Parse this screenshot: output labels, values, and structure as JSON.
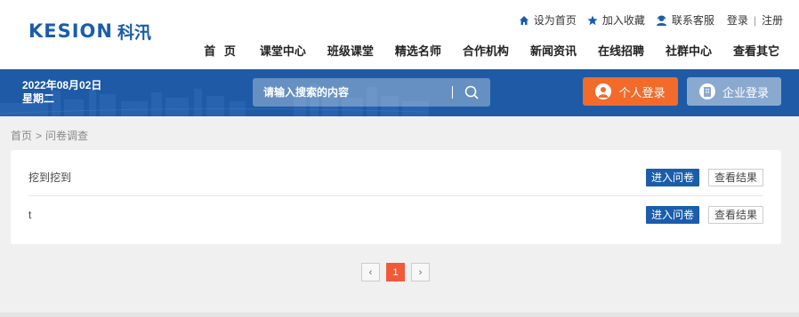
{
  "brand": {
    "logo_text": "KESION",
    "logo_cn": "科汛",
    "color": "#1a5dab"
  },
  "toplinks": [
    {
      "label": "设为首页",
      "icon": "home-icon"
    },
    {
      "label": "加入收藏",
      "icon": "star-icon"
    },
    {
      "label": "联系客服",
      "icon": "customer-service-icon"
    }
  ],
  "auth": {
    "login": "登录",
    "separator": "|",
    "register": "注册"
  },
  "nav": [
    "首 页",
    "课堂中心",
    "班级课堂",
    "精选名师",
    "合作机构",
    "新闻资讯",
    "在线招聘",
    "社群中心",
    "查看其它"
  ],
  "band": {
    "date": "2022年08月02日",
    "weekday": "星期二",
    "search_placeholder": "请输入搜索的内容",
    "personal_login": "个人登录",
    "corp_login": "企业登录",
    "band_color": "#1e5aa6",
    "personal_color": "#f26b2b",
    "corp_color": "#8aa9cf"
  },
  "breadcrumb": {
    "home": "首页",
    "separator": ">",
    "current": "问卷调查"
  },
  "surveys": [
    {
      "title": "挖到挖到",
      "enter": "进入问卷",
      "result": "查看结果"
    },
    {
      "title": "t",
      "enter": "进入问卷",
      "result": "查看结果"
    }
  ],
  "pagination": {
    "prev": "‹",
    "current": "1",
    "next": "›",
    "active_color": "#f05a3a"
  }
}
